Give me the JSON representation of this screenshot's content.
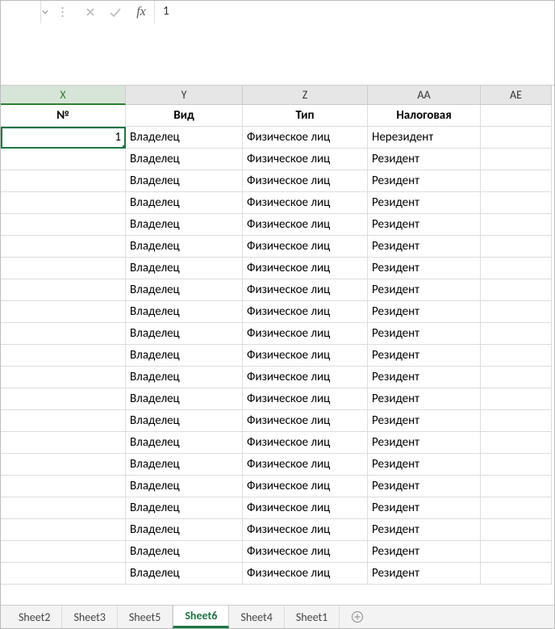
{
  "formula_bar": {
    "name_box": "",
    "value": "1"
  },
  "columns": [
    "X",
    "Y",
    "Z",
    "AA",
    "AE"
  ],
  "headers": [
    "№",
    "Вид",
    "Тип",
    "Налоговая",
    ""
  ],
  "rows": [
    {
      "no": "1",
      "vid": "Владелец",
      "tip": "Физическое лиц",
      "nal": "Нерезидент"
    },
    {
      "no": "",
      "vid": "Владелец",
      "tip": "Физическое лиц",
      "nal": "Резидент"
    },
    {
      "no": "",
      "vid": "Владелец",
      "tip": "Физическое лиц",
      "nal": "Резидент"
    },
    {
      "no": "",
      "vid": "Владелец",
      "tip": "Физическое лиц",
      "nal": "Резидент"
    },
    {
      "no": "",
      "vid": "Владелец",
      "tip": "Физическое лиц",
      "nal": "Резидент"
    },
    {
      "no": "",
      "vid": "Владелец",
      "tip": "Физическое лиц",
      "nal": "Резидент"
    },
    {
      "no": "",
      "vid": "Владелец",
      "tip": "Физическое лиц",
      "nal": "Резидент"
    },
    {
      "no": "",
      "vid": "Владелец",
      "tip": "Физическое лиц",
      "nal": "Резидент"
    },
    {
      "no": "",
      "vid": "Владелец",
      "tip": "Физическое лиц",
      "nal": "Резидент"
    },
    {
      "no": "",
      "vid": "Владелец",
      "tip": "Физическое лиц",
      "nal": "Резидент"
    },
    {
      "no": "",
      "vid": "Владелец",
      "tip": "Физическое лиц",
      "nal": "Резидент"
    },
    {
      "no": "",
      "vid": "Владелец",
      "tip": "Физическое лиц",
      "nal": "Резидент"
    },
    {
      "no": "",
      "vid": "Владелец",
      "tip": "Физическое лиц",
      "nal": "Резидент"
    },
    {
      "no": "",
      "vid": "Владелец",
      "tip": "Физическое лиц",
      "nal": "Резидент"
    },
    {
      "no": "",
      "vid": "Владелец",
      "tip": "Физическое лиц",
      "nal": "Резидент"
    },
    {
      "no": "",
      "vid": "Владелец",
      "tip": "Физическое лиц",
      "nal": "Резидент"
    },
    {
      "no": "",
      "vid": "Владелец",
      "tip": "Физическое лиц",
      "nal": "Резидент"
    },
    {
      "no": "",
      "vid": "Владелец",
      "tip": "Физическое лиц",
      "nal": "Резидент"
    },
    {
      "no": "",
      "vid": "Владелец",
      "tip": "Физическое лиц",
      "nal": "Резидент"
    },
    {
      "no": "",
      "vid": "Владелец",
      "tip": "Физическое лиц",
      "nal": "Резидент"
    },
    {
      "no": "",
      "vid": "Владелец",
      "tip": "Физическое лиц",
      "nal": "Резидент"
    }
  ],
  "tabs": [
    {
      "label": "Sheet2",
      "active": false
    },
    {
      "label": "Sheet3",
      "active": false
    },
    {
      "label": "Sheet5",
      "active": false
    },
    {
      "label": "Sheet6",
      "active": true
    },
    {
      "label": "Sheet4",
      "active": false
    },
    {
      "label": "Sheet1",
      "active": false
    }
  ],
  "icons": {
    "fx": "fx"
  }
}
